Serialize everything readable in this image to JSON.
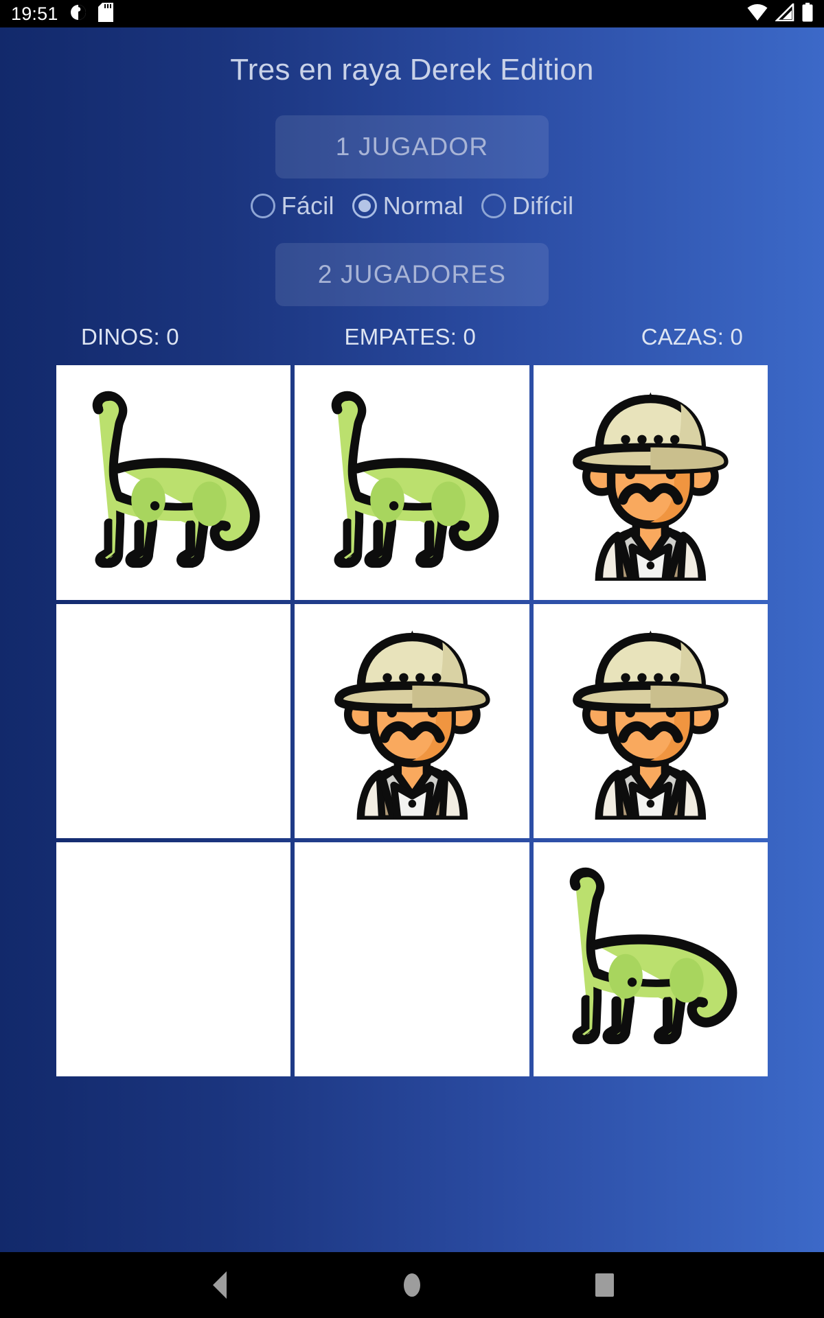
{
  "status_bar": {
    "time": "19:51",
    "left_icons": [
      "do-not-disturb-icon",
      "sd-card-icon"
    ],
    "right_icons": [
      "wifi-icon",
      "cellular-signal-icon",
      "battery-icon"
    ]
  },
  "app": {
    "title": "Tres en raya Derek Edition",
    "background_gradient_from": "#12296b",
    "background_gradient_to": "#3c69c8",
    "title_color": "#c9d2e8"
  },
  "buttons": {
    "one_player": "1 JUGADOR",
    "two_players": "2 JUGADORES",
    "button_text_color": "#a8b4d6"
  },
  "difficulty": {
    "selected": "Normal",
    "options": [
      {
        "label": "Fácil",
        "selected": false
      },
      {
        "label": "Normal",
        "selected": true
      },
      {
        "label": "Difícil",
        "selected": false
      }
    ]
  },
  "scoreboard": {
    "dinos": "DINOS: 0",
    "empates": "EMPATES: 0",
    "cazas": "CAZAS: 0"
  },
  "board": {
    "cells": [
      {
        "index": 0,
        "mark": "dino"
      },
      {
        "index": 1,
        "mark": "dino"
      },
      {
        "index": 2,
        "mark": "hunter"
      },
      {
        "index": 3,
        "mark": ""
      },
      {
        "index": 4,
        "mark": "hunter"
      },
      {
        "index": 5,
        "mark": "hunter"
      },
      {
        "index": 6,
        "mark": ""
      },
      {
        "index": 7,
        "mark": ""
      },
      {
        "index": 8,
        "mark": "dino"
      }
    ],
    "cell_background": "#ffffff",
    "dino_color": "#b5de6a",
    "hunter_hat_color": "#e8e3bb",
    "hunter_skin_color": "#f9a95e"
  },
  "nav_bar": {
    "buttons": [
      "back-button",
      "home-button",
      "recents-button"
    ],
    "icon_color": "#9d9d9d"
  }
}
